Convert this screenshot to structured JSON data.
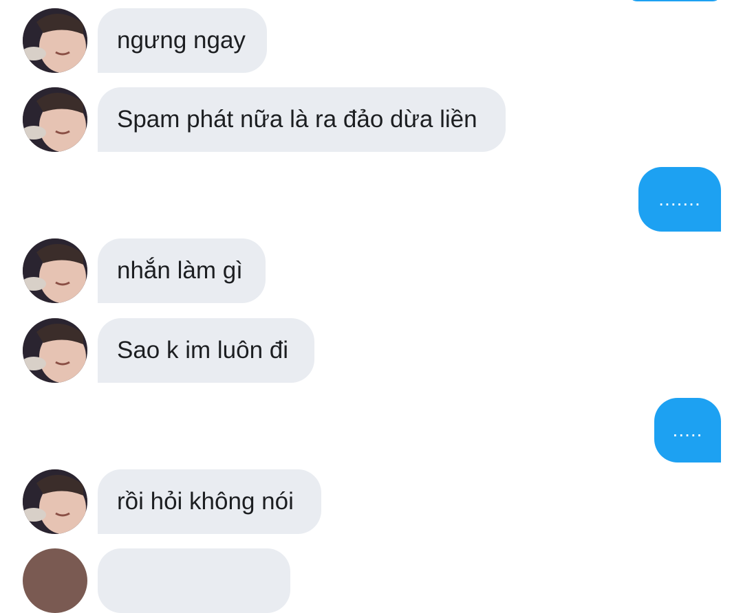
{
  "messages": [
    {
      "direction": "incoming",
      "text": "ngưng ngay"
    },
    {
      "direction": "incoming",
      "text": "Spam phát nữa là ra đảo dừa liền"
    },
    {
      "direction": "outgoing",
      "text": "......."
    },
    {
      "direction": "incoming",
      "text": "nhắn làm gì"
    },
    {
      "direction": "incoming",
      "text": "Sao k im luôn đi"
    },
    {
      "direction": "outgoing",
      "text": "....."
    },
    {
      "direction": "incoming",
      "text": "rồi hỏi không nói"
    }
  ],
  "colors": {
    "incoming_bubble": "#e9ecf1",
    "incoming_text": "#1c1e21",
    "outgoing_bubble": "#1da1f2",
    "outgoing_text": "#ffffff"
  },
  "icons": {
    "avatar": "contact-avatar-photo"
  }
}
